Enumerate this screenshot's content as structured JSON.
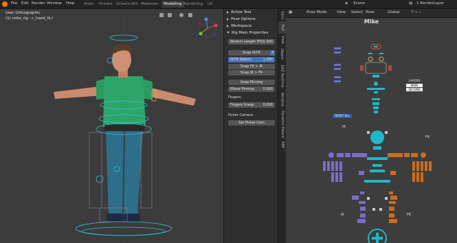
{
  "topbar": {
    "menu": [
      "File",
      "Edit",
      "Render",
      "Window",
      "Help"
    ],
    "workspace_tabs": [
      "Anim",
      "Drivers",
      "Drivers.001",
      "Materials",
      "Modelling",
      "Rendering",
      "UV"
    ],
    "active_tab": "Modelling",
    "scene": "Scene",
    "render_layer": "1 RenderLayer"
  },
  "viewport": {
    "view_name": "User Orthographic",
    "object_info": "(1) mike_rig : c_hand_fk.l"
  },
  "npanel": {
    "active_tool": "Active Tool",
    "pose_options": "Pose Options",
    "workspace": "Workspace",
    "rig_main_properties": "Rig Main Properties",
    "stretch_length_label": "Stretch Length (FK):",
    "stretch_length_value": "1.000",
    "snap_ik_fk": "Snap IK-FK",
    "ik_fk_switch_label": "IK-FK Switch:",
    "ik_fk_switch_value": "1.000",
    "snap_fk_ik": "Snap FK > IK",
    "snap_ik_fk_2": "Snap IK > FK",
    "snap_pinning": "Snap Pinning",
    "elbow_pinning_label": "Elbow Pinning",
    "elbow_pinning_value": "0.000",
    "fingers_label": "Fingers:",
    "fingers_grasp_label": "Fingers Grasp:",
    "fingers_grasp_value": "0.000",
    "picker_camera_label": "Picker Camera",
    "set_picker_cam": "Set Picker Cam"
  },
  "side_tabs": [
    "Item",
    "Tool",
    "View",
    "Object",
    "DAZ Runtime",
    "Rename",
    "Dynamic Parent",
    "ARP"
  ],
  "picker": {
    "header": [
      "Pose Mode",
      "View",
      "Select",
      "Pose",
      "Global"
    ],
    "title": "Mike",
    "reset_all": "RESET ALL",
    "layers_title": "LAYERS",
    "layer_main": "MAIN",
    "layer_second": "SECOND",
    "ik_label_left": "IK",
    "fk_label_right": "FK",
    "ik_label_bottom": "IK",
    "fk_label_bottom": "FK"
  },
  "colors": {
    "accent": "#4772b3",
    "center": "#1fb7c8",
    "ik": "#7b6bd0",
    "fk": "#cc6d1c"
  }
}
